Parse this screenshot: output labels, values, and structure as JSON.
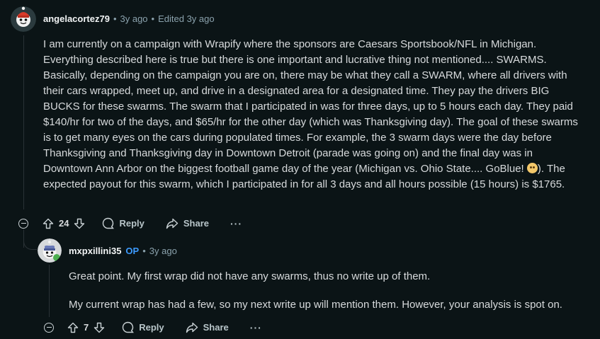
{
  "comment1": {
    "author": "angelacortez79",
    "age": "3y ago",
    "edited": "Edited 3y ago",
    "body_part1": "I am currently on a campaign with Wrapify where the sponsors are Caesars Sportsbook/NFL in Michigan. Everything described here is true but there is one important and lucrative thing not mentioned.... SWARMS. Basically, depending on the campaign you are on, there may be what they call a SWARM, where all drivers with their cars wrapped, meet up, and drive in a designated area for a designated time. They pay the drivers BIG BUCKS for these swarms. The swarm that I participated in was for three days, up to 5 hours each day. They paid $140/hr for two of the days, and $65/hr for the other day (which was Thanksgiving day). The goal of these swarms is to get many eyes on the cars during populated times. For example, the 3 swarm days were the day before Thanksgiving and Thanksgiving day in Downtown Detroit (parade was going on) and the final day was in Downtown Ann Arbor on the biggest football game day of the year (Michigan vs. Ohio State.... GoBlue! ",
    "body_part2": "). The expected payout for this swarm, which I participated in for all 3 days and all hours possible (15 hours) is $1765.",
    "votes": "24",
    "reply_label": "Reply",
    "share_label": "Share",
    "more_label": "···"
  },
  "comment2": {
    "author": "mxpxillini35",
    "op_badge": "OP",
    "age": "3y ago",
    "paragraphs": [
      "Great point. My first wrap did not have any swarms, thus no write up of them.",
      "My current wrap has had a few, so my next write up will mention them. However, your analysis is spot on."
    ],
    "votes": "7",
    "reply_label": "Reply",
    "share_label": "Share",
    "more_label": "···"
  },
  "icons": {
    "upvote": "upvote-icon",
    "downvote": "downvote-icon",
    "reply": "comment-bubble-icon",
    "share": "share-arrow-icon",
    "collapse": "collapse-minus-icon",
    "emoji": "smiley-emoji-icon"
  },
  "colors": {
    "background": "#0b1416",
    "op": "#3d9bff",
    "text": "#d7dadc",
    "muted": "#8ba2ad"
  }
}
